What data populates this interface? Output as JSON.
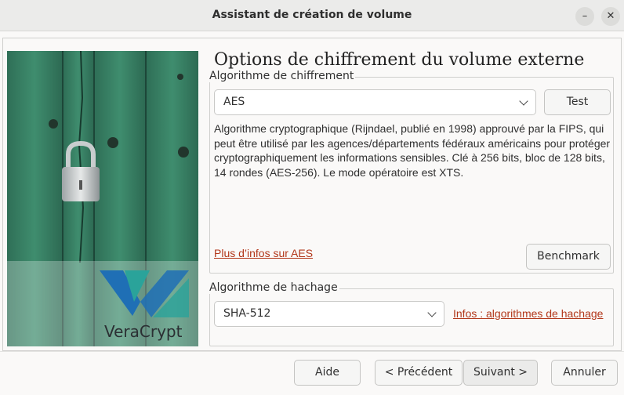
{
  "window": {
    "title": "Assistant de création de volume",
    "minimize_glyph": "–",
    "close_glyph": "✕"
  },
  "page": {
    "heading": "Options de chiffrement du volume externe"
  },
  "encryption": {
    "group_label": "Algorithme de chiffrement",
    "selected_algorithm": "AES",
    "test_label": "Test",
    "description": "Algorithme cryptographique (Rijndael, publié en 1998) approuvé par la FIPS, qui peut être utilisé par les agences/départements fédéraux américains pour protéger cryptographiquement les informations sensibles. Clé à 256 bits, bloc de 128 bits, 14 rondes (AES-256). Le mode opératoire est XTS.",
    "more_info_link": "Plus d’infos sur AES",
    "benchmark_label": "Benchmark"
  },
  "hash": {
    "group_label": "Algorithme de hachage",
    "selected_algorithm": "SHA-512",
    "info_link": "Infos : algorithmes de hachage"
  },
  "footer": {
    "help_label": "Aide",
    "previous_label": "< Précédent",
    "next_label": "Suivant >",
    "cancel_label": "Annuler"
  },
  "brand": {
    "logo_text": "VeraCrypt",
    "colors": {
      "logo_blue": "#1f6fb5",
      "logo_teal": "#2aa39a",
      "link": "#b2371a",
      "door_green": "#3c8a6c"
    }
  },
  "icons": {
    "combo_arrow": "chevron-down-icon"
  }
}
